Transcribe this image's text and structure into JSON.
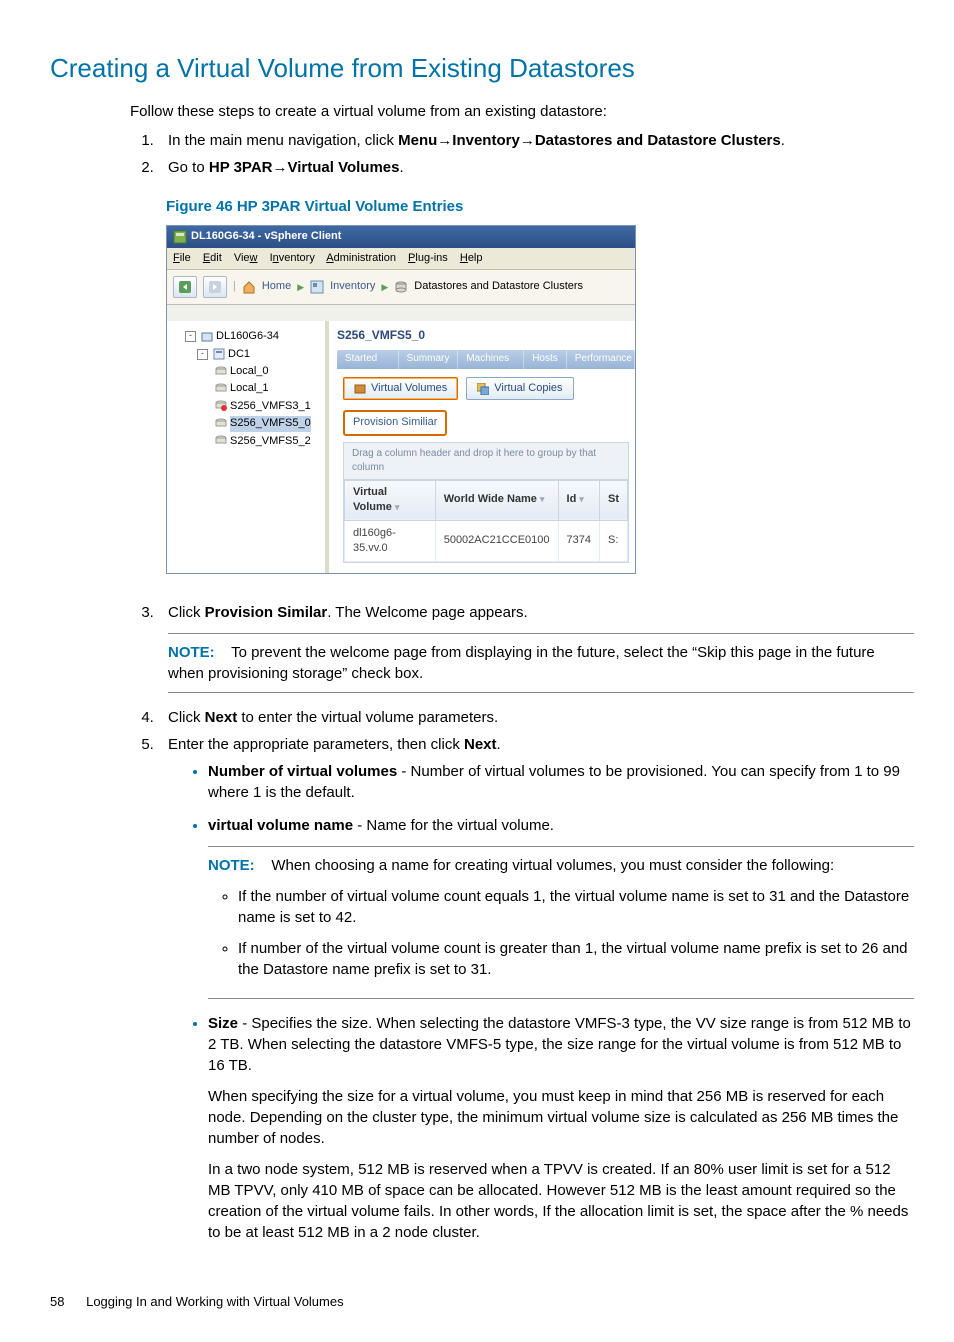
{
  "title": "Creating a Virtual Volume from Existing Datastores",
  "intro": "Follow these steps to create a virtual volume from an existing datastore:",
  "steps": {
    "s1_a": "In the main menu navigation, click ",
    "s1_menu": "Menu",
    "s1_inv": "Inventory",
    "s1_ds": "Datastores and Datastore Clusters",
    "s2_a": "Go to ",
    "s2_hp": "HP 3PAR",
    "s2_vv": "Virtual Volumes",
    "s3_a": "Click ",
    "s3_b": "Provision Similar",
    "s3_c": ". The Welcome page appears.",
    "s4_a": "Click ",
    "s4_b": "Next",
    "s4_c": " to enter the virtual volume parameters.",
    "s5_a": "Enter the appropriate parameters, then click ",
    "s5_b": "Next"
  },
  "figure_caption": "Figure 46 HP 3PAR Virtual Volume Entries",
  "note1": {
    "label": "NOTE:",
    "text": "To prevent the welcome page from displaying in the future, select the “Skip this page in the future when provisioning storage” check box."
  },
  "params": {
    "num_label": "Number of virtual volumes",
    "num_text": " - Number of virtual volumes to be provisioned. You can specify from 1 to 99 where 1 is the default.",
    "name_label": "virtual volume name",
    "name_text": " - Name for the virtual volume.",
    "note2_label": "NOTE:",
    "note2_text": "When choosing a name for creating virtual volumes, you must consider the following:",
    "sub_a": "If the number of virtual volume count equals 1, the virtual volume name is set to 31 and the Datastore name is set to 42.",
    "sub_b": "If number of the virtual volume count is greater than 1, the virtual volume name prefix is set to 26 and the Datastore name prefix is set to 31.",
    "size_label": "Size ",
    "size_text": " - Specifies the size. When selecting the datastore VMFS-3 type, the VV size range is from 512 MB to 2 TB. When selecting the datastore VMFS-5 type, the size range for the virtual volume is from 512 MB to 16 TB.",
    "size_p2": "When specifying the size for a virtual volume, you must keep in mind that 256 MB is reserved for each node. Depending on the cluster type, the minimum virtual volume size is calculated as 256 MB times the number of nodes.",
    "size_p3": "In a two node system, 512 MB is reserved when a TPVV is created. If an 80% user limit is set for a 512 MB TPVV, only 410 MB of space can be allocated. However 512 MB is the least amount required so the creation of the virtual volume fails. In other words, If the allocation limit is set, the space after the % needs to be at least 512 MB in a 2 node cluster."
  },
  "screenshot": {
    "window_title": "DL160G6-34 - vSphere Client",
    "menus": {
      "file": "File",
      "edit": "Edit",
      "view": "View",
      "inventory": "Inventory",
      "admin": "Administration",
      "plugins": "Plug-ins",
      "help": "Help"
    },
    "breadcrumb": {
      "home": "Home",
      "inventory": "Inventory",
      "dest": "Datastores and Datastore Clusters"
    },
    "tree": {
      "root": "DL160G6-34",
      "dc": "DC1",
      "items": [
        "Local_0",
        "Local_1",
        "S256_VMFS3_1",
        "S256_VMFS5_0",
        "S256_VMFS5_2"
      ],
      "selected": "S256_VMFS5_0"
    },
    "pane_title": "S256_VMFS5_0",
    "tabs": [
      "Getting Started",
      "Summary",
      "Virtual Machines",
      "Hosts",
      "Performance"
    ],
    "buttons": {
      "vv": "Virtual Volumes",
      "vc": "Virtual Copies"
    },
    "provision": "Provision Similiar",
    "grid_hint": "Drag a column header and drop it here to group by that column",
    "columns": {
      "c1": "Virtual Volume",
      "c2": "World Wide Name",
      "c3": "Id",
      "c4": "St"
    },
    "row": {
      "vv": "dl160g6-35.vv.0",
      "wwn": "50002AC21CCE0100",
      "id": "7374",
      "st": "S:"
    }
  },
  "footer": {
    "page": "58",
    "section": "Logging In and Working with Virtual Volumes"
  }
}
